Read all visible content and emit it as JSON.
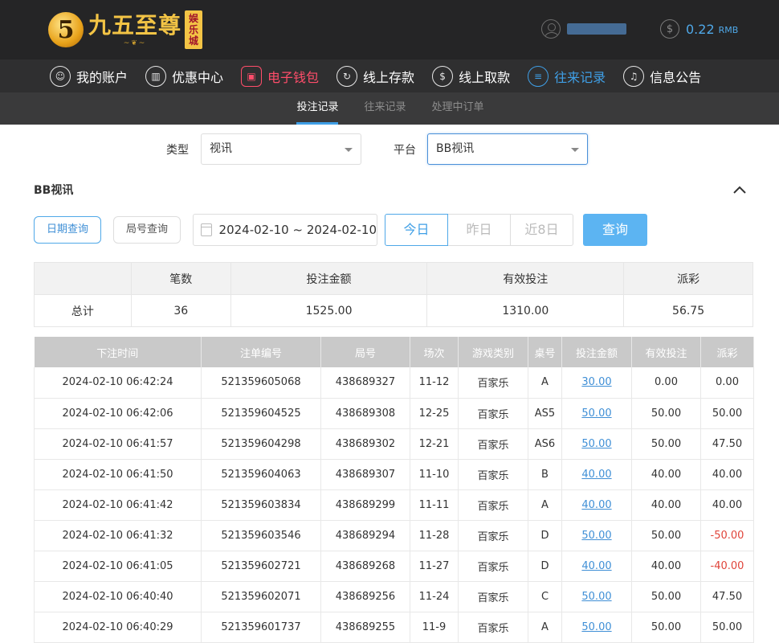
{
  "brand": {
    "logo_digit": "5",
    "name": "九五至尊",
    "tag": [
      "娱",
      "乐",
      "城"
    ],
    "deco": "~❦~"
  },
  "account": {
    "balance": "0.22",
    "unit": "RMB"
  },
  "nav": [
    {
      "label": "我的账户",
      "icon": "user-circle-icon",
      "glyph": "☺",
      "state": "normal"
    },
    {
      "label": "优惠中心",
      "icon": "gift-icon",
      "glyph": "▥",
      "state": "normal"
    },
    {
      "label": "电子钱包",
      "icon": "wallet-icon",
      "glyph": "▣",
      "state": "red"
    },
    {
      "label": "线上存款",
      "icon": "deposit-icon",
      "glyph": "↻",
      "state": "normal"
    },
    {
      "label": "线上取款",
      "icon": "withdraw-icon",
      "glyph": "$",
      "state": "normal"
    },
    {
      "label": "往来记录",
      "icon": "records-icon",
      "glyph": "≡",
      "state": "blue"
    },
    {
      "label": "信息公告",
      "icon": "bell-icon",
      "glyph": "♫",
      "state": "normal"
    }
  ],
  "subtabs": [
    {
      "label": "投注记录",
      "active": true
    },
    {
      "label": "往来记录",
      "active": false
    },
    {
      "label": "处理中订单",
      "active": false
    }
  ],
  "filter": {
    "type_label": "类型",
    "type_value": "视讯",
    "platform_label": "平台",
    "platform_value": "BB视讯"
  },
  "section_title": "BB视讯",
  "query": {
    "date_query": "日期查询",
    "round_query": "局号查询",
    "date_range": "2024-02-10 ~ 2024-02-10",
    "today": "今日",
    "yesterday": "昨日",
    "last8": "近8日",
    "search": "查询"
  },
  "summary": {
    "headers": [
      "笔数",
      "投注金额",
      "有效投注",
      "派彩"
    ],
    "row_label": "总计",
    "values": [
      "36",
      "1525.00",
      "1310.00",
      "56.75"
    ]
  },
  "records": {
    "headers": [
      "下注时间",
      "注单编号",
      "局号",
      "场次",
      "游戏类别",
      "桌号",
      "投注金额",
      "有效投注",
      "派彩"
    ],
    "rows": [
      [
        "2024-02-10 06:42:24",
        "521359605068",
        "438689327",
        "11-12",
        "百家乐",
        "A",
        "30.00",
        "0.00",
        "0.00"
      ],
      [
        "2024-02-10 06:42:06",
        "521359604525",
        "438689308",
        "12-25",
        "百家乐",
        "AS5",
        "50.00",
        "50.00",
        "50.00"
      ],
      [
        "2024-02-10 06:41:57",
        "521359604298",
        "438689302",
        "12-21",
        "百家乐",
        "AS6",
        "50.00",
        "50.00",
        "47.50"
      ],
      [
        "2024-02-10 06:41:50",
        "521359604063",
        "438689307",
        "11-10",
        "百家乐",
        "B",
        "40.00",
        "40.00",
        "40.00"
      ],
      [
        "2024-02-10 06:41:42",
        "521359603834",
        "438689299",
        "11-11",
        "百家乐",
        "A",
        "40.00",
        "40.00",
        "40.00"
      ],
      [
        "2024-02-10 06:41:32",
        "521359603546",
        "438689294",
        "11-28",
        "百家乐",
        "D",
        "50.00",
        "50.00",
        "-50.00"
      ],
      [
        "2024-02-10 06:41:05",
        "521359602721",
        "438689268",
        "11-27",
        "百家乐",
        "D",
        "40.00",
        "40.00",
        "-40.00"
      ],
      [
        "2024-02-10 06:40:40",
        "521359602071",
        "438689256",
        "11-24",
        "百家乐",
        "C",
        "50.00",
        "50.00",
        "47.50"
      ],
      [
        "2024-02-10 06:40:29",
        "521359601737",
        "438689255",
        "11-9",
        "百家乐",
        "A",
        "50.00",
        "50.00",
        "50.00"
      ]
    ]
  },
  "colors": {
    "accent": "#3f9fe6",
    "nav_red": "#ff4d6a",
    "negative": "#e0443a",
    "balance": "#4fa8e8"
  }
}
